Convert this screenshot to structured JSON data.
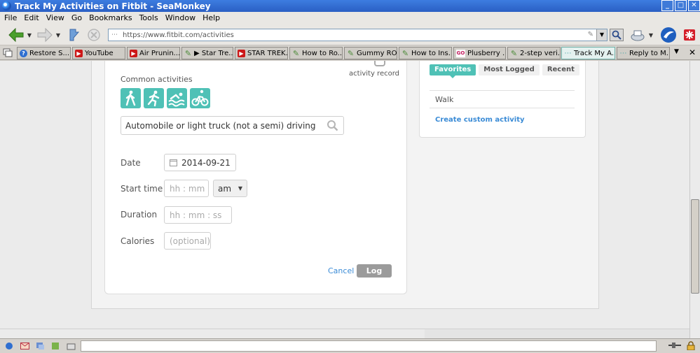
{
  "window": {
    "title": "Track My Activities on Fitbit - SeaMonkey",
    "buttons": [
      "_",
      "□",
      "✕"
    ]
  },
  "menu": [
    "File",
    "Edit",
    "View",
    "Go",
    "Bookmarks",
    "Tools",
    "Window",
    "Help"
  ],
  "toolbar": {
    "url": "https://www.fitbit.com/activities",
    "icons": [
      "back-icon",
      "forward-icon",
      "reload-icon",
      "stop-icon",
      "search-icon",
      "mail-icon",
      "seamonkey-icon",
      "addon-icon"
    ]
  },
  "tabs": [
    {
      "label": "Restore S...",
      "icon": "q"
    },
    {
      "label": "YouTube",
      "icon": "yt"
    },
    {
      "label": "Air Prunin...",
      "icon": "yt"
    },
    {
      "label": "▶ Star Tre...",
      "icon": "clip"
    },
    {
      "label": "STAR TREK...",
      "icon": "yt"
    },
    {
      "label": "How to Ro...",
      "icon": "clip"
    },
    {
      "label": "Gummy RO...",
      "icon": "clip"
    },
    {
      "label": "How to Ins...",
      "icon": "clip"
    },
    {
      "label": "Plusberry ...",
      "icon": "go"
    },
    {
      "label": "2-step veri...",
      "icon": "clip"
    },
    {
      "label": "Track My A...",
      "icon": "fb",
      "active": true
    },
    {
      "label": "Reply to M...",
      "icon": "fb"
    }
  ],
  "form": {
    "activity_record_label": "activity record",
    "common_activities_label": "Common activities",
    "search_value": "Automobile or light truck (not a semi) driving",
    "date_label": "Date",
    "date_value": "2014-09-21",
    "start_time_label": "Start time",
    "start_time_placeholder": "hh  : mm",
    "ampm_value": "am",
    "duration_label": "Duration",
    "duration_placeholder": "hh  : mm :  ss",
    "calories_label": "Calories",
    "calories_placeholder": "(optional)",
    "cancel_label": "Cancel",
    "log_label": "Log"
  },
  "sidebar": {
    "tabs": [
      "Favorites",
      "Most Logged",
      "Recent"
    ],
    "active_tab": "Favorites",
    "items": [
      "Walk"
    ],
    "custom_link": "Create custom activity"
  },
  "colors": {
    "accent": "#4fc1b6",
    "link": "#3a8bd6",
    "log_button": "#9b9b9b"
  }
}
